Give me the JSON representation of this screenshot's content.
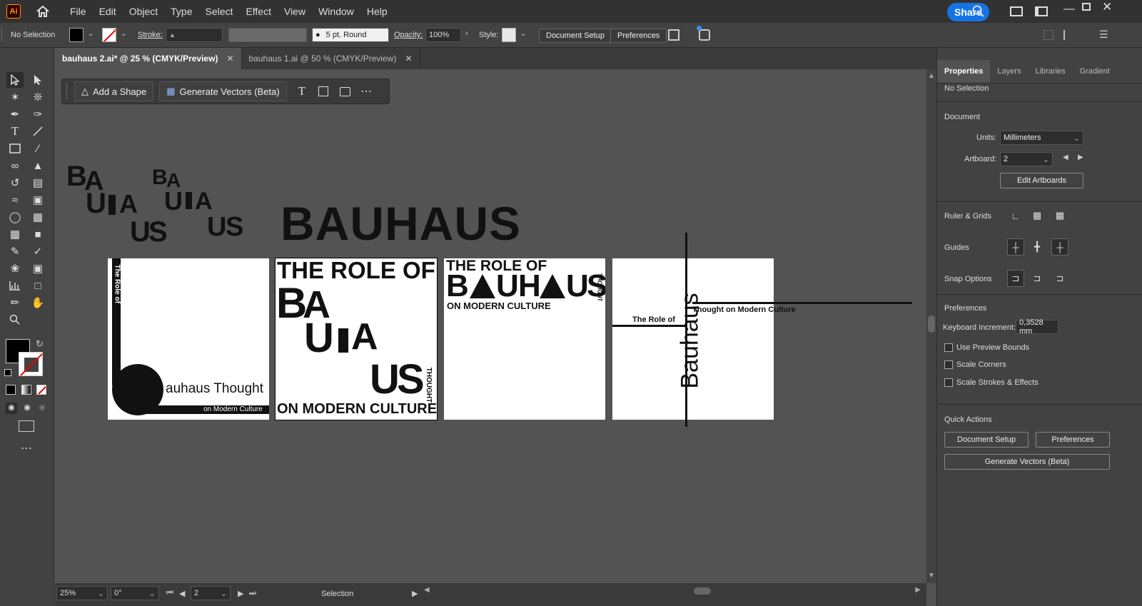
{
  "app": {
    "logo": "Ai"
  },
  "menu": [
    "File",
    "Edit",
    "Object",
    "Type",
    "Select",
    "Effect",
    "View",
    "Window",
    "Help"
  ],
  "share_label": "Share",
  "control": {
    "selection": "No Selection",
    "stroke_label": "Stroke:",
    "brush_value": "5 pt. Round",
    "opacity_label": "Opacity:",
    "opacity_value": "100%",
    "style_label": "Style:",
    "document_setup": "Document Setup",
    "preferences": "Preferences"
  },
  "tabs": [
    {
      "label": "bauhaus 2.ai* @ 25 % (CMYK/Preview)",
      "active": true
    },
    {
      "label": "bauhaus 1.ai @ 50 % (CMYK/Preview)",
      "active": false
    }
  ],
  "context_bar": {
    "add_shape": "Add a Shape",
    "generate_vectors": "Generate Vectors (Beta)"
  },
  "canvas": {
    "logo_letters": {
      "b": "B",
      "a": "A",
      "u": "U",
      "h": "H",
      "s": "S"
    },
    "wordmark": "BAUHAUS",
    "ab1": {
      "vertical": "The Role of",
      "main": "auhaus Thought",
      "sub": "on Modern Culture"
    },
    "ab2": {
      "top": "THE ROLE OF",
      "b": "B",
      "a": "A",
      "u": "U",
      "s": "S",
      "side": "THOUGHT",
      "bottom": "ON MODERN CULTURE"
    },
    "ab3": {
      "top": "THE ROLE OF",
      "b": "B",
      "a": "A",
      "u": "U",
      "h": "H",
      "s": "S",
      "side": "THOUGHT",
      "bottom": "ON MODERN CULTURE"
    },
    "ab4": {
      "role": "The Role of",
      "vertical": "Bauhaus",
      "thought": "Thought on Modern Culture"
    }
  },
  "status": {
    "zoom": "25%",
    "rotation": "0°",
    "artboard": "2",
    "tool": "Selection"
  },
  "panel": {
    "tabs": [
      "Properties",
      "Layers",
      "Libraries",
      "Gradient"
    ],
    "selection": "No Selection",
    "document": "Document",
    "units_label": "Units:",
    "units_value": "Millimeters",
    "artboard_label": "Artboard:",
    "artboard_value": "2",
    "edit_artboards": "Edit Artboards",
    "ruler_grids": "Ruler & Grids",
    "guides": "Guides",
    "snap_options": "Snap Options",
    "preferences": "Preferences",
    "keyboard_increment_label": "Keyboard Increment:",
    "keyboard_increment_value": "0,3528 mm",
    "use_preview_bounds": "Use Preview Bounds",
    "scale_corners": "Scale Corners",
    "scale_strokes": "Scale Strokes & Effects",
    "quick_actions": "Quick Actions",
    "qa_document_setup": "Document Setup",
    "qa_preferences": "Preferences",
    "qa_generate_vectors": "Generate Vectors (Beta)"
  }
}
